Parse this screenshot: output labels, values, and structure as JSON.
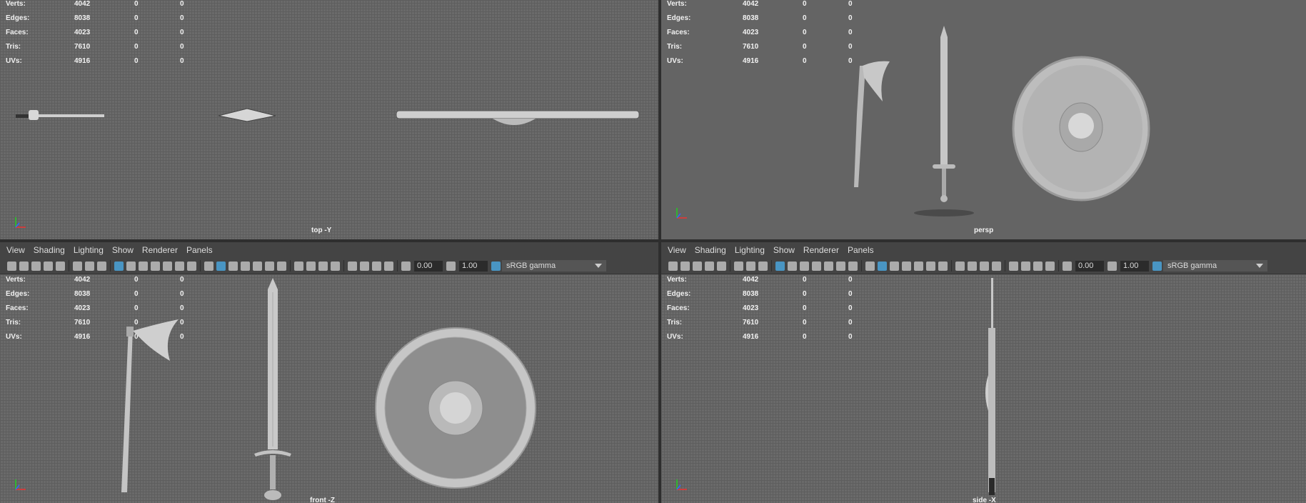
{
  "stats": {
    "rows": [
      {
        "label": "Verts:",
        "v1": "4042",
        "v2": "0",
        "v3": "0"
      },
      {
        "label": "Edges:",
        "v1": "8038",
        "v2": "0",
        "v3": "0"
      },
      {
        "label": "Faces:",
        "v1": "4023",
        "v2": "0",
        "v3": "0"
      },
      {
        "label": "Tris:",
        "v1": "7610",
        "v2": "0",
        "v3": "0"
      },
      {
        "label": "UVs:",
        "v1": "4916",
        "v2": "0",
        "v3": "0"
      }
    ]
  },
  "panel_menu": [
    "View",
    "Shading",
    "Lighting",
    "Show",
    "Renderer",
    "Panels"
  ],
  "toolbar": {
    "exposure": "0.00",
    "gamma": "1.00",
    "color_space": "sRGB gamma"
  },
  "viewports": {
    "top_left": {
      "camera": "top -Y"
    },
    "top_right": {
      "camera": "persp"
    },
    "bottom_left": {
      "camera": "front -Z"
    },
    "bottom_right": {
      "camera": "side -X"
    }
  },
  "colors": {
    "active_icon": "#4aa3d9",
    "viewport_bg": "#646464",
    "panel_bg": "#444444"
  }
}
